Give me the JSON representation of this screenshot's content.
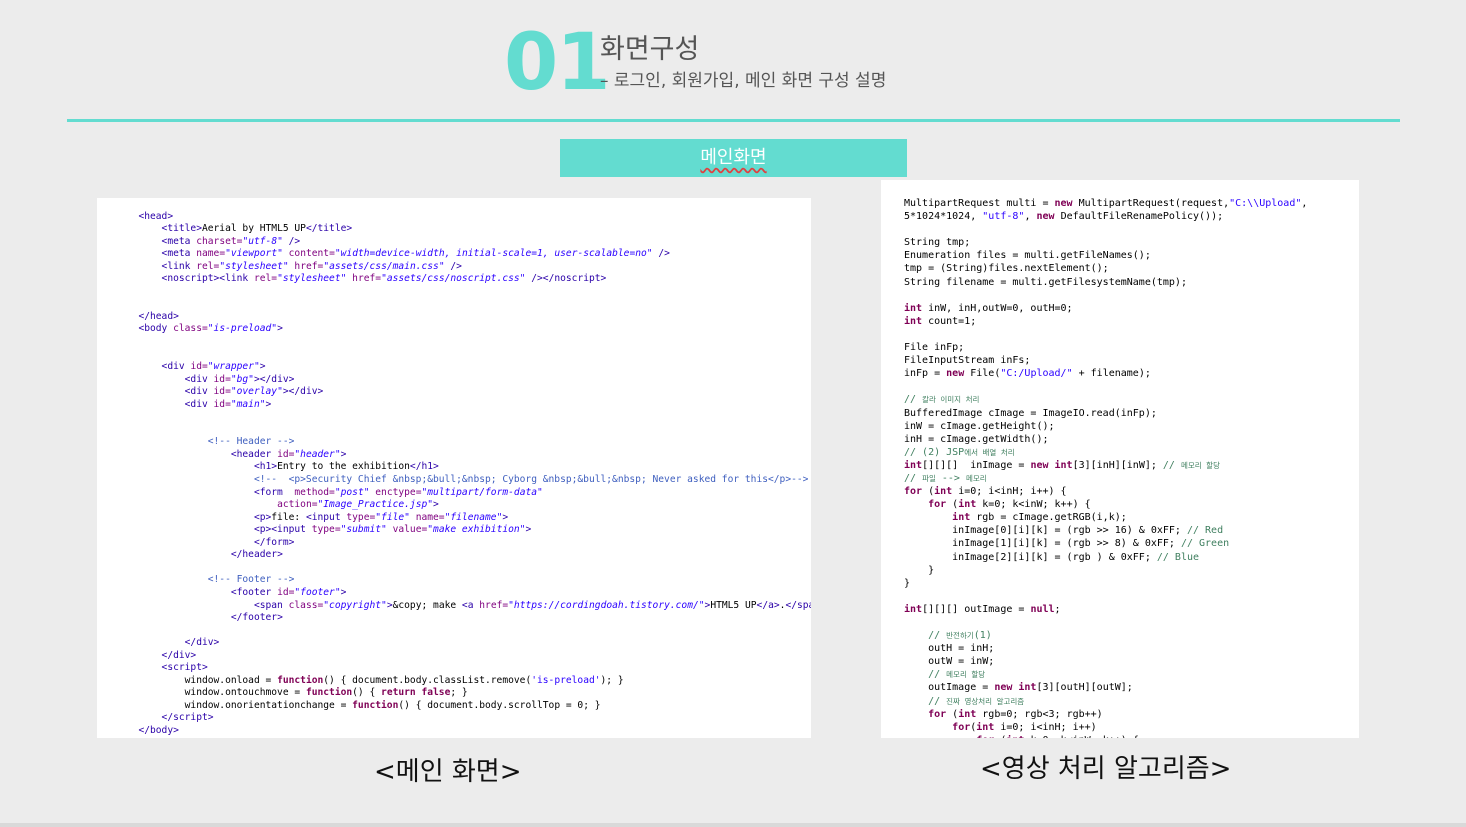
{
  "header": {
    "number": "01",
    "title": "화면구성",
    "subtitle": "– 로그인, 회원가입, 메인 화면 구성 설명"
  },
  "section_tag": "메인화면",
  "captions": {
    "left": "<메인 화면>",
    "right": "<영상 처리 알고리즘>"
  },
  "colors": {
    "accent": "#63dcd0",
    "background": "#ececec",
    "text": "#555555"
  }
}
